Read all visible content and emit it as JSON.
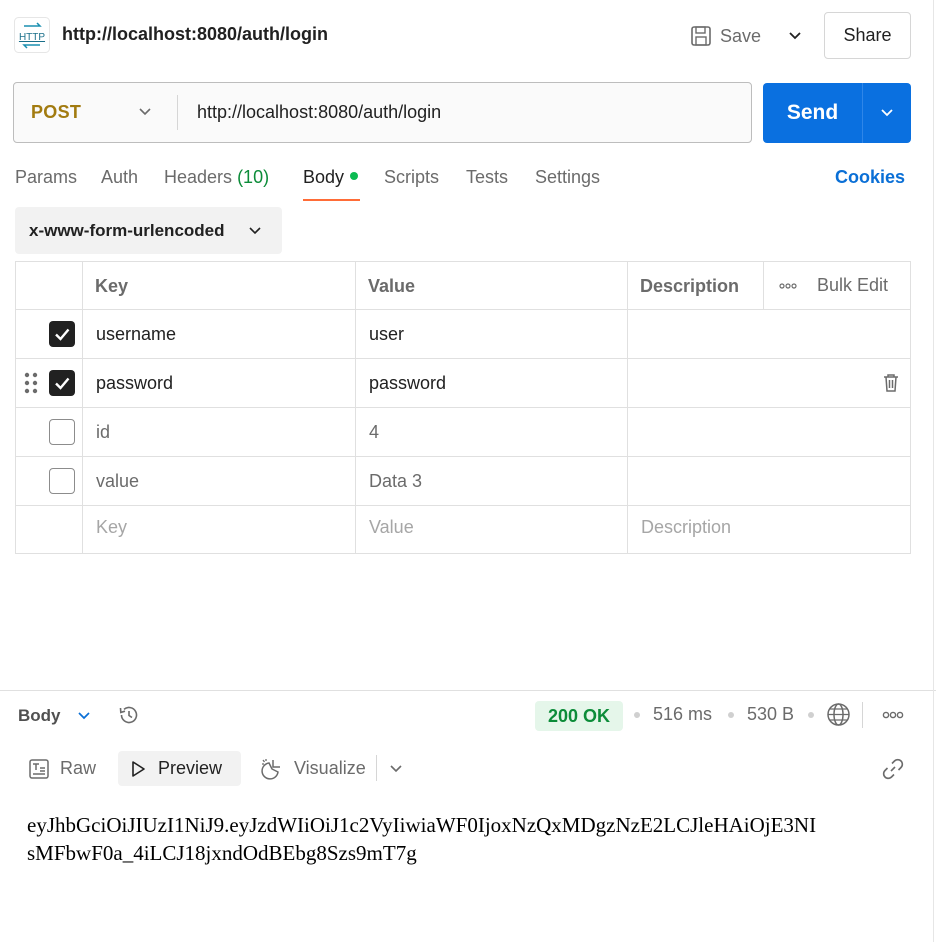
{
  "request": {
    "title": "http://localhost:8080/auth/login",
    "icon": "http-icon",
    "method": "POST",
    "method_color": "#A27B10",
    "url": "http://localhost:8080/auth/login"
  },
  "toolbar": {
    "save_label": "Save",
    "share_label": "Share",
    "send_label": "Send",
    "send_color": "#0A70E0"
  },
  "tabs": [
    {
      "label": "Params"
    },
    {
      "label": "Auth"
    },
    {
      "label": "Headers",
      "count": "(10)"
    },
    {
      "label": "Body",
      "active": true,
      "indicator": "green-dot"
    },
    {
      "label": "Scripts"
    },
    {
      "label": "Tests"
    },
    {
      "label": "Settings"
    }
  ],
  "cookies_label": "Cookies",
  "body": {
    "type": "x-www-form-urlencoded",
    "columns": {
      "key": "Key",
      "value": "Value",
      "description": "Description",
      "bulk_edit": "Bulk Edit"
    },
    "rows": [
      {
        "checked": true,
        "key": "username",
        "value": "user",
        "description": ""
      },
      {
        "checked": true,
        "key": "password",
        "value": "password",
        "description": ""
      },
      {
        "checked": false,
        "key": "id",
        "value": "4",
        "description": ""
      },
      {
        "checked": false,
        "key": "value",
        "value": "Data 3",
        "description": ""
      }
    ],
    "placeholders": {
      "key": "Key",
      "value": "Value",
      "description": "Description"
    }
  },
  "response": {
    "section_label": "Body",
    "status": "200 OK",
    "status_color": "#0C8C39",
    "time": "516 ms",
    "size": "530 B",
    "views": {
      "raw": "Raw",
      "preview": "Preview",
      "visualize": "Visualize"
    },
    "active_view": "Preview",
    "preview_lines": [
      "eyJhbGciOiJIUzI1NiJ9.eyJzdWIiOiJ1c2VyIiwiaWF0IjoxNzQxMDgzNzE2LCJleHAiOjE3NI",
      "sMFbwF0a_4iLCJ18jxndOdBEbg8Szs9mT7g"
    ]
  }
}
